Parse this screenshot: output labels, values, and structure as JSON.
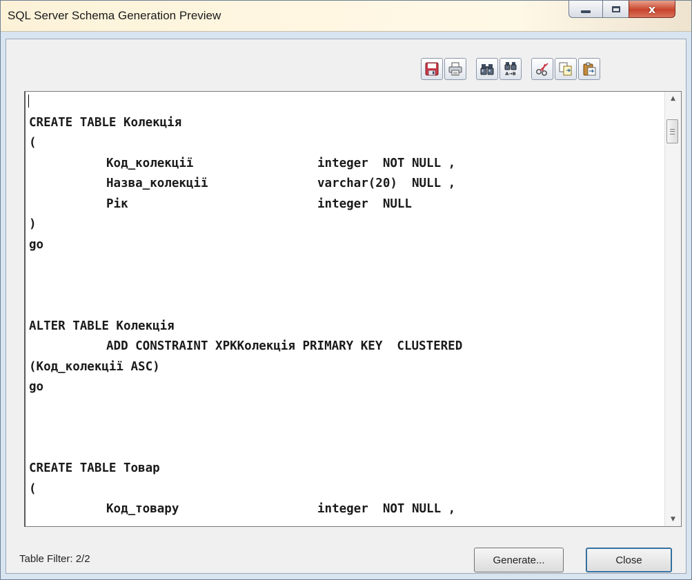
{
  "window": {
    "title": "SQL Server Schema Generation Preview",
    "caption_buttons": [
      "minimize-icon",
      "maximize-icon",
      "close-icon"
    ],
    "close_glyph": "x"
  },
  "toolbar": {
    "buttons": [
      {
        "name": "save-button",
        "icon": "save-icon"
      },
      {
        "name": "print-button",
        "icon": "print-icon"
      },
      {
        "name": "find-button",
        "icon": "binoculars-icon"
      },
      {
        "name": "find-replace-button",
        "icon": "find-replace-icon",
        "glyph_text": "A→B"
      },
      {
        "name": "edit-button",
        "icon": "edit-icon"
      },
      {
        "name": "copy-button",
        "icon": "copy-icon"
      },
      {
        "name": "paste-button",
        "icon": "paste-icon"
      }
    ]
  },
  "editor": {
    "lines": [
      {
        "segments": []
      },
      {
        "segments": [
          {
            "text": "CREATE TABLE Колекція"
          }
        ]
      },
      {
        "segments": [
          {
            "text": "("
          }
        ]
      },
      {
        "segments": [
          {
            "text": "Код_колекції"
          },
          {
            "text": "integer  NOT NULL ,"
          }
        ]
      },
      {
        "segments": [
          {
            "text": "Назва_колекції"
          },
          {
            "text": "varchar(20)  NULL ,"
          }
        ]
      },
      {
        "segments": [
          {
            "text": "Рік"
          },
          {
            "text": "integer  NULL"
          }
        ]
      },
      {
        "segments": [
          {
            "text": ")"
          }
        ]
      },
      {
        "segments": [
          {
            "text": "go"
          }
        ]
      },
      {
        "segments": []
      },
      {
        "segments": []
      },
      {
        "segments": []
      },
      {
        "segments": [
          {
            "text": "ALTER TABLE Колекція"
          }
        ]
      },
      {
        "segments": [
          {
            "text": "ADD CONSTRAINT XPKКолекція PRIMARY KEY  CLUSTERED"
          }
        ]
      },
      {
        "segments": [
          {
            "text": "(Код_колекції ASC)"
          }
        ]
      },
      {
        "segments": [
          {
            "text": "go"
          }
        ]
      },
      {
        "segments": []
      },
      {
        "segments": []
      },
      {
        "segments": []
      },
      {
        "segments": [
          {
            "text": "CREATE TABLE Товар"
          }
        ]
      },
      {
        "segments": [
          {
            "text": "("
          }
        ]
      },
      {
        "segments": [
          {
            "text": "Код_товару"
          },
          {
            "text": "integer  NOT NULL ,"
          }
        ]
      }
    ],
    "scrollbar": {
      "up_arrow": "▲",
      "down_arrow": "▼"
    }
  },
  "footer": {
    "filter_label": "Table Filter: 2/2",
    "generate_label": "Generate...",
    "close_label": "Close"
  }
}
